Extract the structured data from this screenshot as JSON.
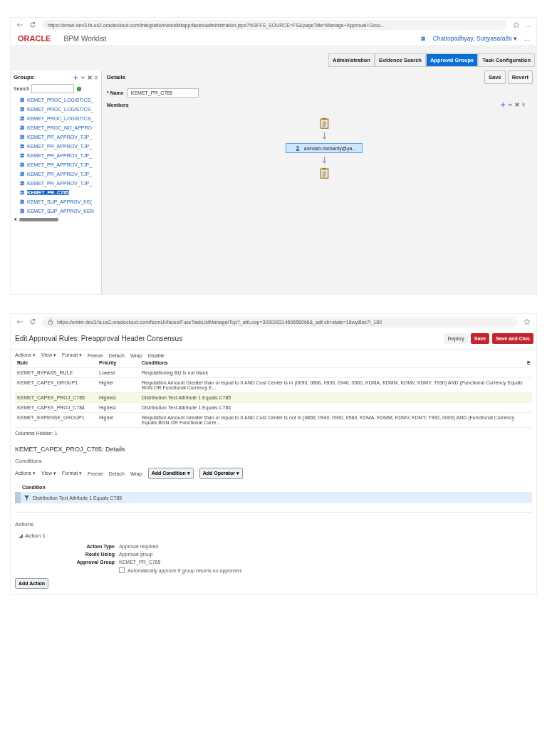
{
  "worklist": {
    "address": "https://emiw-dev3.fa.us2.oraclecloud.com/integration/worklistapp/faces/administration.jspx?%3FFS_SOURCE=FS&pageTitle=Manage+Approval+Grou...",
    "brand": "ORACLE",
    "app_title": "BPM Worklist",
    "user": "Chattopadhyay, Surjyasarathi ▾",
    "more": "...",
    "tabs": [
      {
        "label": "Administration",
        "selected": false
      },
      {
        "label": "Evidence Search",
        "selected": false
      },
      {
        "label": "Approval Groups",
        "selected": true
      },
      {
        "label": "Task Configuration",
        "selected": false
      }
    ],
    "buttons": [
      "Save",
      "Revert"
    ],
    "groups": {
      "title": "Groups",
      "search_label": "Search",
      "items": [
        {
          "label": "KEMET_PROC_LOGISTICS_",
          "selected": false
        },
        {
          "label": "KEMET_PROC_LOGISTICS_",
          "selected": false
        },
        {
          "label": "KEMET_PROC_LOGISTICS_",
          "selected": false
        },
        {
          "label": "KEMET_PROC_NO_APPRO",
          "selected": false
        },
        {
          "label": "KEMET_PR_APPROV_TJP_",
          "selected": false
        },
        {
          "label": "KEMET_PR_APPROV_TJP_",
          "selected": false
        },
        {
          "label": "KEMET_PR_APPROV_TJP_",
          "selected": false
        },
        {
          "label": "KEMET_PR_APPROV_TJP_",
          "selected": false
        },
        {
          "label": "KEMET_PR_APPROV_TJP_",
          "selected": false
        },
        {
          "label": "KEMET_PR_APPROV_TJP_",
          "selected": false
        },
        {
          "label": "KEMET_PR_C785",
          "selected": true
        },
        {
          "label": "KEMET_SUP_APPROV_KE(",
          "selected": false
        },
        {
          "label": "KEMET_SUP_APPROV_KEN",
          "selected": false
        }
      ]
    },
    "details": {
      "title": "Details",
      "name_label": "* Name",
      "name_value": "KEMET_PR_C785",
      "members_label": "Members",
      "member": "avinash.mohanty@ya..."
    }
  },
  "rules_editor": {
    "address": "https://emiw-dev3.fa.us2.oraclecloud.com/fscmUI/faces/FuseTaskListManagerTop?_afrLoop=30302631459658066&_adf.ctrl-state=16wyi8se7i_180",
    "title": "Edit Approval Rules: Preapproval Header Consensus",
    "buttons": [
      {
        "label": "Deploy",
        "kind": "plain"
      },
      {
        "label": "Save",
        "kind": "primary"
      },
      {
        "label": "Save and Clos",
        "kind": "primary"
      }
    ],
    "toolbar": [
      "Actions ▾",
      "View ▾",
      "Format ▾",
      "Freeze",
      "Detach",
      "Wrap",
      "Disable"
    ],
    "columns": [
      "Rule",
      "Priority",
      "Conditions",
      "E"
    ],
    "rows": [
      {
        "rule": "KEMET_BYPASS_RULE",
        "priority": "Lowest",
        "conditions": "Requisitioning BU is not blank",
        "selected": false
      },
      {
        "rule": "KEMET_CAPEX_GROUP1",
        "priority": "Higher",
        "conditions": "Requisition Amount Greater than or equal to 0 AND Cost Center is in (0090, 0866, 0930, 0940, 0560, KDMA, KDMM, KDMV, KDMY, T930) AND (Functional Currency Equals BGN OR Functional Currency E...",
        "selected": false
      },
      {
        "rule": "KEMET_CAPEX_PROJ_C785",
        "priority": "Highest",
        "conditions": "Distribution Text Attribute 1 Equals C785",
        "selected": true
      },
      {
        "rule": "KEMET_CAPEX_PROJ_C784",
        "priority": "Highest",
        "conditions": "Distribution Text Attribute 1 Equals C784",
        "selected": false
      },
      {
        "rule": "KEMET_EXPENSE_GROUP1",
        "priority": "Higher",
        "conditions": "Requisition Amount Greater than or equal to 0 AND Cost Center is not in (0866, 0940, 0930, 0560, KDMA, KDMM, KDMV, KDMY, T930, 0000) AND (Functional Currency Equals BGN OR Functional Curre...",
        "selected": false
      }
    ],
    "columns_hidden": "Columns Hidden: 1",
    "details_title": "KEMET_CAPEX_PROJ_C785: Details",
    "conditions": {
      "title": "Conditions",
      "toolbar": [
        "Actions ▾",
        "View ▾",
        "Format ▾",
        "Freeze",
        "Detach",
        "Wrap"
      ],
      "add_buttons": [
        "Add Condition ▾",
        "Add Operator ▾"
      ],
      "column": "Condition",
      "row": "Distribution Text Attribute 1 Equals C785"
    },
    "actions": {
      "title": "Actions",
      "action": "Action 1",
      "fields": [
        {
          "label": "Action Type",
          "value": "Approval required"
        },
        {
          "label": "Route Using",
          "value": "Approval group"
        },
        {
          "label": "Approval Group",
          "value": "KEMET_PR_C785"
        }
      ],
      "auto_approve_checked": false,
      "auto_approve": "Automatically approve if group returns no approvers",
      "add_button": "Add Action"
    }
  }
}
